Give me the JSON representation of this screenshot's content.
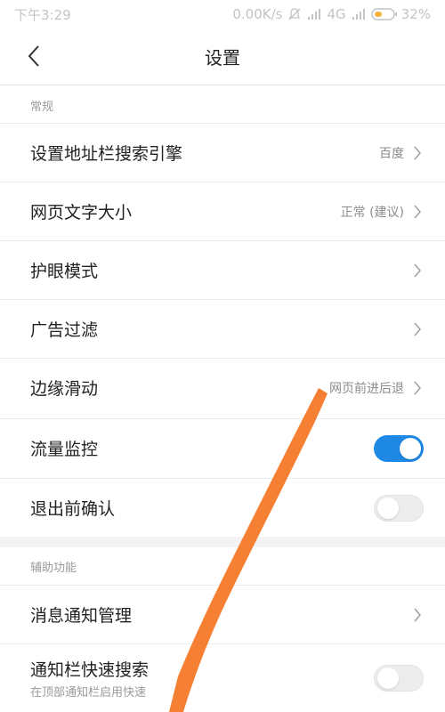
{
  "status_bar": {
    "time": "下午3:29",
    "network_speed": "0.00K/s",
    "network_type": "4G",
    "battery": "32%",
    "icons": [
      "alarm-off-icon",
      "signal-icon",
      "signal-icon",
      "battery-icon"
    ]
  },
  "header": {
    "title": "设置",
    "back_icon": "chevron-left-icon"
  },
  "sections": {
    "general": {
      "title": "常规",
      "items": [
        {
          "label": "设置地址栏搜索引擎",
          "value": "百度"
        },
        {
          "label": "网页文字大小",
          "value": "正常 (建议)"
        },
        {
          "label": "护眼模式",
          "value": ""
        },
        {
          "label": "广告过滤",
          "value": ""
        },
        {
          "label": "边缘滑动",
          "value": "网页前进后退"
        },
        {
          "label": "流量监控",
          "toggle": true
        },
        {
          "label": "退出前确认",
          "toggle": false
        }
      ]
    },
    "accessibility": {
      "title": "辅助功能",
      "items": [
        {
          "label": "消息通知管理",
          "value": ""
        },
        {
          "label": "通知栏快速搜索",
          "sublabel": "在顶部通知栏启用快速",
          "toggle": false
        }
      ]
    }
  },
  "colors": {
    "accent": "#1e88e5",
    "annotation_stroke": "#f57a2a"
  }
}
